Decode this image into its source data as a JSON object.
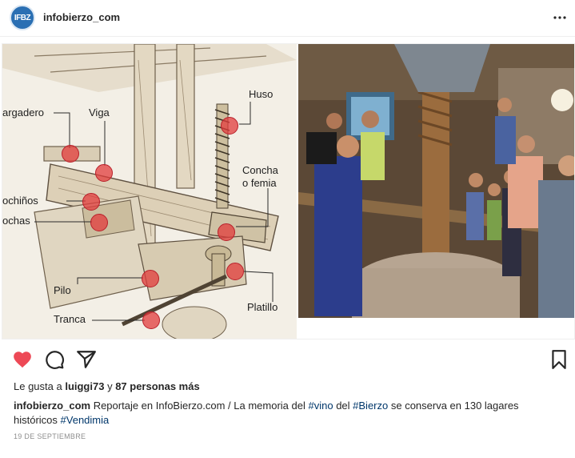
{
  "header": {
    "avatar_text": "IFBZ",
    "username": "infobierzo_com",
    "more_icon": "more-horizontal-icon"
  },
  "diagram": {
    "labels": {
      "cargadero": "argadero",
      "viga": "Viga",
      "huso": "Huso",
      "concha": "Concha",
      "o_femia": "o femia",
      "cochinos": "ochiños",
      "cochas": "ochas",
      "pilo": "Pilo",
      "platillo": "Platillo",
      "tranca": "Tranca"
    }
  },
  "actions": {
    "like_icon": "heart-filled-icon",
    "comment_icon": "comment-icon",
    "share_icon": "send-icon",
    "save_icon": "bookmark-icon",
    "like_color": "#ed4956"
  },
  "likes": {
    "prefix": "Le gusta a ",
    "user": "luiggi73",
    "middle": " y ",
    "count_text": "87 personas más"
  },
  "caption": {
    "user": "infobierzo_com",
    "text_1": " Reportaje en InfoBierzo.com /  La memoria del ",
    "tag_1": "#vino",
    "text_2": " del ",
    "tag_2": "#Bierzo",
    "text_3": " se conserva en 130 lagares históricos ",
    "tag_3": "#Vendimia"
  },
  "date": "19 DE SEPTIEMBRE",
  "colors": {
    "hashtag": "#00376b",
    "brand_avatar": "#2a6fb3"
  }
}
